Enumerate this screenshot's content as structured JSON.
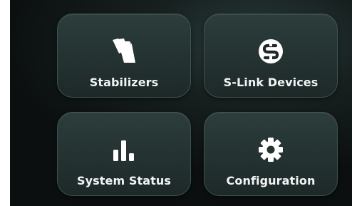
{
  "colors": {
    "tile_background": "#26353a",
    "tile_border": "#3e5251",
    "text": "#f2f4f4",
    "icon": "#ffffff"
  },
  "menu": {
    "tiles": [
      {
        "label": "Stabilizers",
        "icon": "stacked-papers-icon"
      },
      {
        "label": "S-Link Devices",
        "icon": "s-link-logo-icon"
      },
      {
        "label": "System Status",
        "icon": "bar-chart-icon"
      },
      {
        "label": "Configuration",
        "icon": "gear-icon"
      }
    ]
  }
}
